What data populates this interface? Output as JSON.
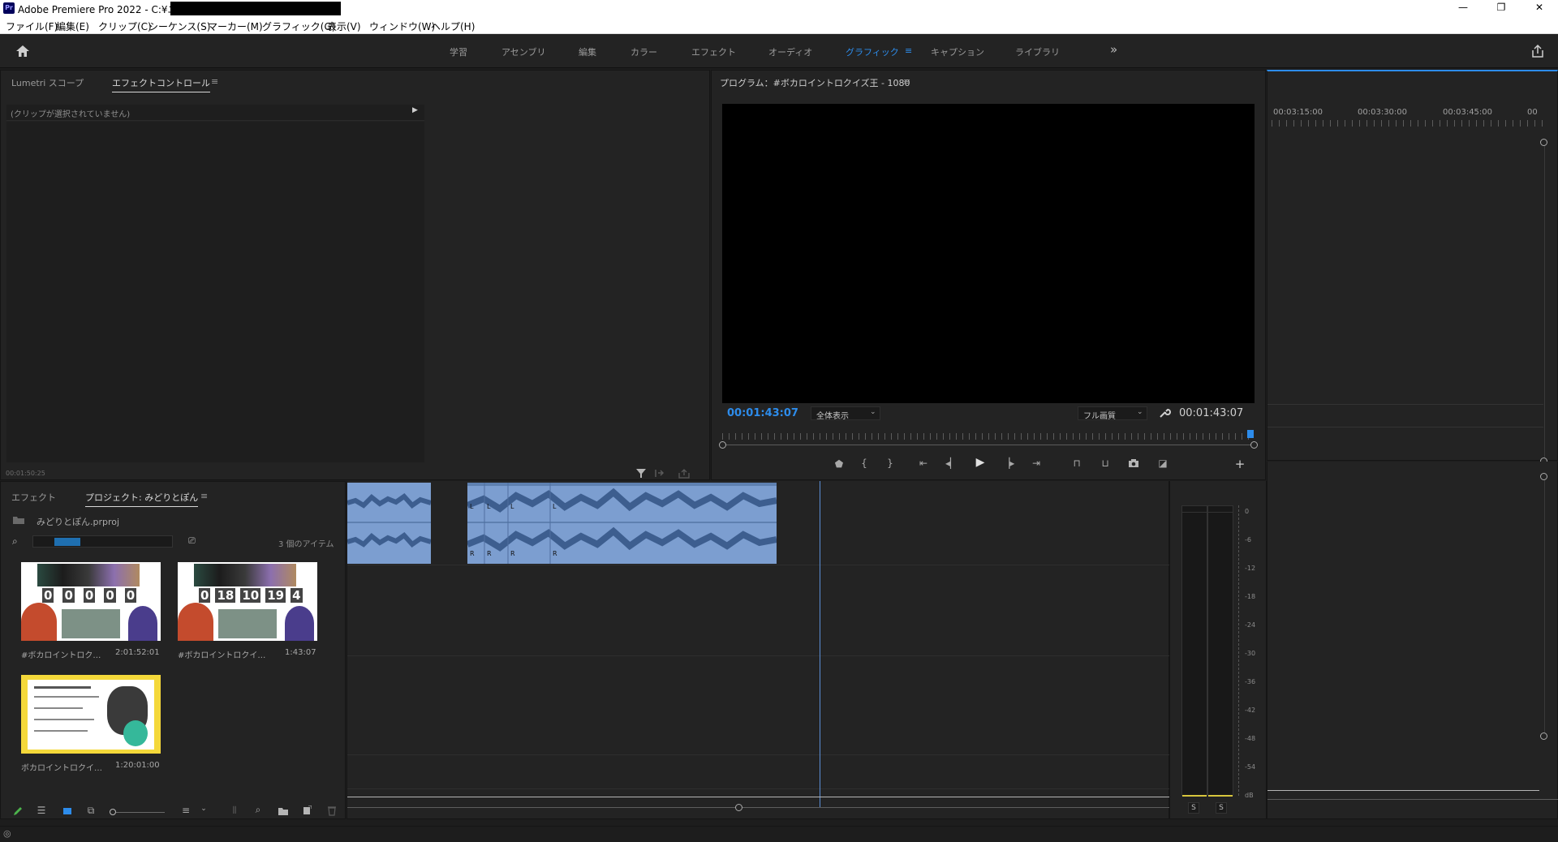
{
  "window": {
    "title": "Adobe Premiere Pro 2022 - C:¥ユーザー¥",
    "app_badge": "Pr",
    "controls": {
      "minimize": "—",
      "restore": "❐",
      "close": "✕"
    }
  },
  "menu": [
    "ファイル(F)",
    "編集(E)",
    "クリップ(C)",
    "シーケンス(S)",
    "マーカー(M)",
    "グラフィック(G)",
    "表示(V)",
    "ウィンドウ(W)",
    "ヘルプ(H)"
  ],
  "workspaces": {
    "tabs": [
      "学習",
      "アセンブリ",
      "編集",
      "カラー",
      "エフェクト",
      "オーディオ",
      "グラフィック",
      "キャプション",
      "ライブラリ"
    ],
    "active": "グラフィック",
    "menu_glyph": "≡",
    "more_glyph": "»"
  },
  "source_panel": {
    "tabs": [
      "Lumetri スコープ",
      "エフェクトコントロール"
    ],
    "active_tab": "エフェクトコントロール",
    "menu_glyph": "≡",
    "no_clip_text": "(クリップが選択されていません)",
    "timecode": "00:01:50:25"
  },
  "program_monitor": {
    "title": "プログラム：#ボカロイントロクイズ王 - 1080",
    "menu_glyph": "≡",
    "current_timecode": "00:01:43:07",
    "zoom_select": "全体表示",
    "quality_select": "フル画質",
    "duration_timecode": "00:01:43:07"
  },
  "ruler": {
    "labels": [
      "00:03:15:00",
      "00:03:30:00",
      "00:03:45:00",
      "00"
    ]
  },
  "project_panel": {
    "tabs": [
      "エフェクト",
      "プロジェクト: みどりとぽん"
    ],
    "active_tab": "プロジェクト: みどりとぽん",
    "menu_glyph": "≡",
    "project_file": "みどりとぽん.prproj",
    "item_count": "3 個のアイテム",
    "items": [
      {
        "name": "#ボカロイントロク…",
        "duration": "2:01:52:01",
        "scores": [
          "0",
          "0",
          "0",
          "0",
          "0"
        ]
      },
      {
        "name": "#ボカロイントロクイ…",
        "duration": "1:43:07",
        "scores": [
          "0",
          "18",
          "10",
          "19",
          "4"
        ]
      },
      {
        "name": "ボカロイントロクイ…",
        "duration": "1:20:01:00",
        "scores": []
      }
    ]
  },
  "audio_meter": {
    "labels": [
      "0",
      "-6",
      "-12",
      "-18",
      "-24",
      "-30",
      "-36",
      "-42",
      "-48",
      "-54",
      "dB"
    ],
    "solo_labels": [
      "S",
      "S"
    ]
  },
  "clip_labels": {
    "left": "L",
    "right": "R"
  },
  "colors": {
    "accent": "#2d8ceb",
    "audio_clip": "#7c9ed0",
    "panel_bg": "#232323",
    "app_bg": "#1d1d1d"
  }
}
